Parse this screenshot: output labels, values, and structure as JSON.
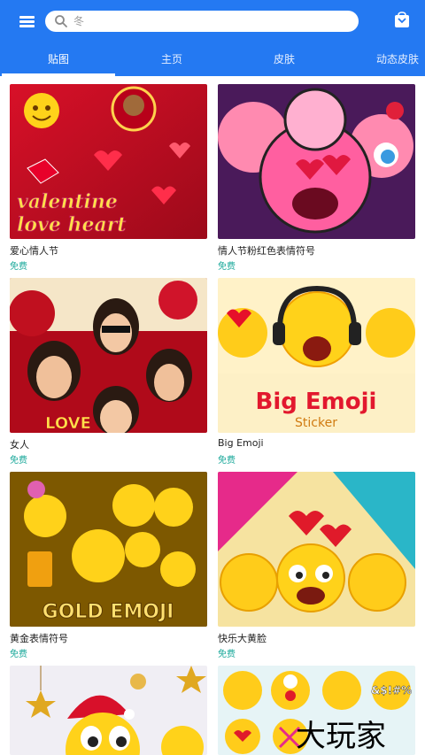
{
  "search": {
    "placeholder": "冬",
    "value": ""
  },
  "tabs": [
    {
      "label": "贴图",
      "active": true
    },
    {
      "label": "主页",
      "active": false
    },
    {
      "label": "皮肤",
      "active": false
    },
    {
      "label": "动态皮肤",
      "active": false
    }
  ],
  "cards": [
    {
      "title": "爱心情人节",
      "price": "免费",
      "thumb_text": [
        "valentine",
        "love heart"
      ]
    },
    {
      "title": "情人节粉红色表情符号",
      "price": "免费"
    },
    {
      "title": "女人",
      "price": "免费",
      "thumb_text": [
        "LOVE"
      ]
    },
    {
      "title": "Big Emoji",
      "price": "免费",
      "thumb_text": [
        "Big Emoji",
        "Sticker"
      ]
    },
    {
      "title": "黄金表情符号",
      "price": "免费",
      "thumb_text": [
        "GOLD EMOJI"
      ]
    },
    {
      "title": "快乐大黄脸",
      "price": "免费"
    },
    {
      "title": "",
      "price": ""
    },
    {
      "title": "",
      "price": "",
      "thumb_text": [
        "&$!#%"
      ]
    }
  ],
  "watermark": "大玩家",
  "colors": {
    "header": "#2479f2",
    "price": "#1aa89a"
  }
}
